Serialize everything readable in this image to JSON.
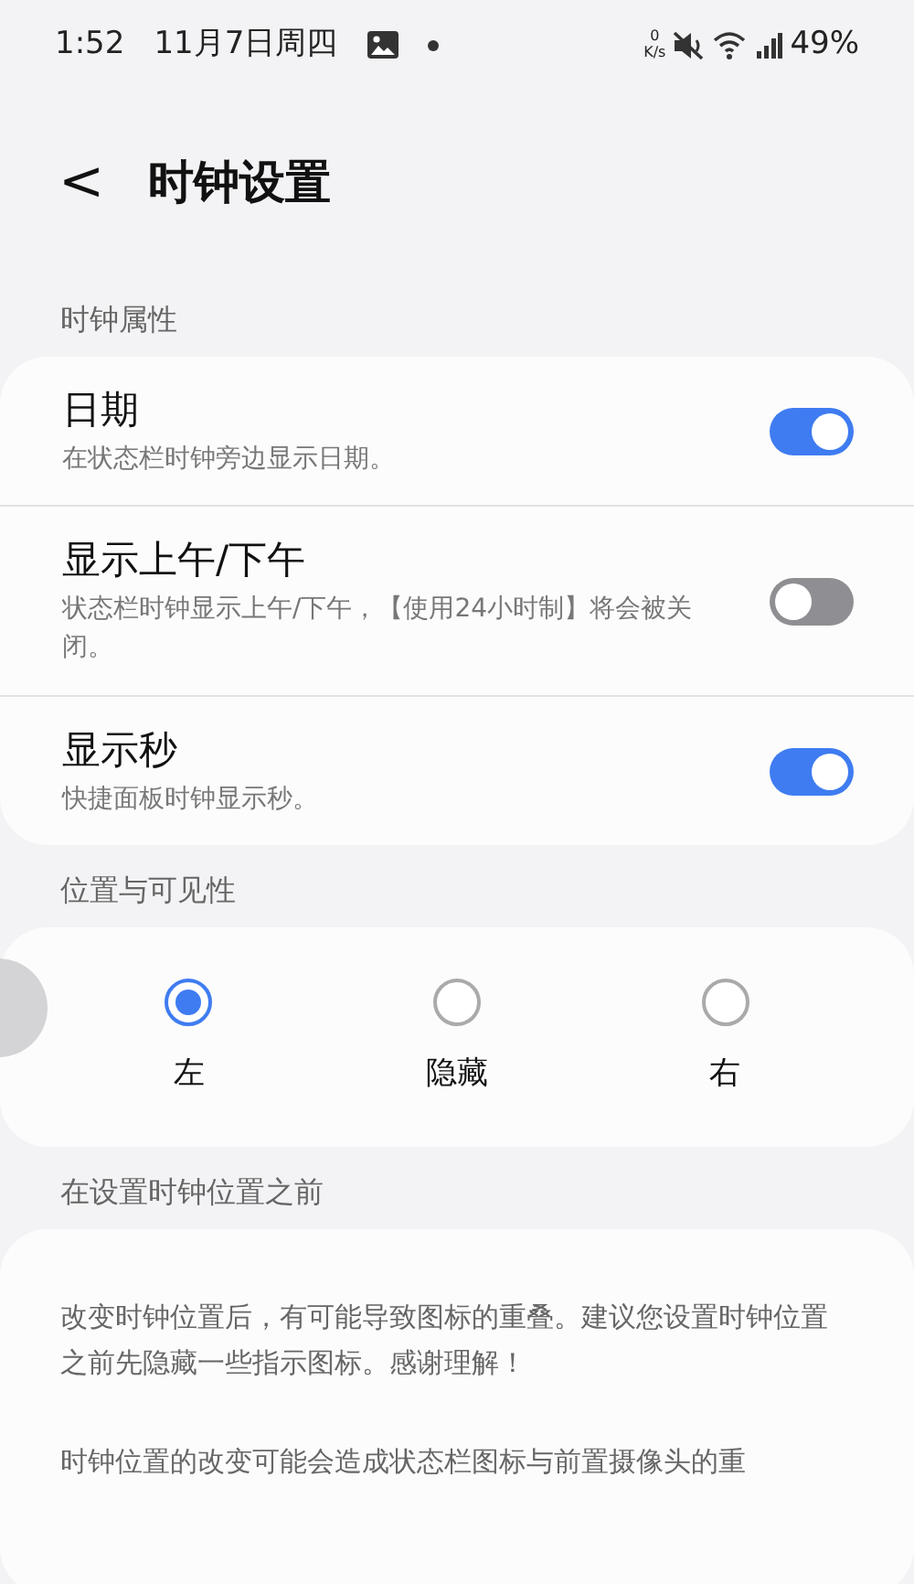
{
  "status_bar": {
    "time": "1:52",
    "date": "11月7日周四",
    "net_speed_value": "0",
    "net_speed_unit": "K/s",
    "battery": "49%"
  },
  "header": {
    "back": "<",
    "title": "时钟设置"
  },
  "sections": [
    {
      "title": "时钟属性",
      "kind": "toggles",
      "items": [
        {
          "title": "日期",
          "subtitle": "在状态栏时钟旁边显示日期。",
          "on": true
        },
        {
          "title": "显示上午/下午",
          "subtitle": "状态栏时钟显示上午/下午，【使用24小时制】将会被关闭。",
          "on": false
        },
        {
          "title": "显示秒",
          "subtitle": "快捷面板时钟显示秒。",
          "on": true
        }
      ]
    },
    {
      "title": "位置与可见性",
      "kind": "radios",
      "items": [
        {
          "label": "左",
          "selected": true
        },
        {
          "label": "隐藏",
          "selected": false
        },
        {
          "label": "右",
          "selected": false
        }
      ]
    },
    {
      "title": "在设置时钟位置之前",
      "kind": "notes",
      "items": [
        {
          "text": "改变时钟位置后，有可能导致图标的重叠。建议您设置时钟位置之前先隐藏一些指示图标。感谢理解！"
        },
        {
          "text": "时钟位置的改变可能会造成状态栏图标与前置摄像头的重"
        }
      ]
    }
  ]
}
